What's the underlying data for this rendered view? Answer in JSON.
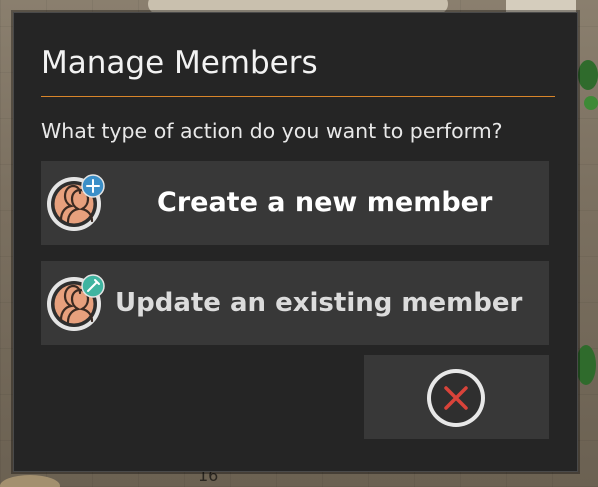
{
  "dialog": {
    "title": "Manage Members",
    "prompt": "What type of action do you want to perform?",
    "accent_color": "#d9852a"
  },
  "actions": [
    {
      "label": "Create a new member",
      "icon": "member-add-icon",
      "badge_color": "#3b8fc8"
    },
    {
      "label": "Update an existing member",
      "icon": "member-edit-icon",
      "badge_color": "#3fb4a0"
    }
  ],
  "close": {
    "icon": "close-icon",
    "color": "#d9433a"
  },
  "background": {
    "visible_number": "16"
  }
}
